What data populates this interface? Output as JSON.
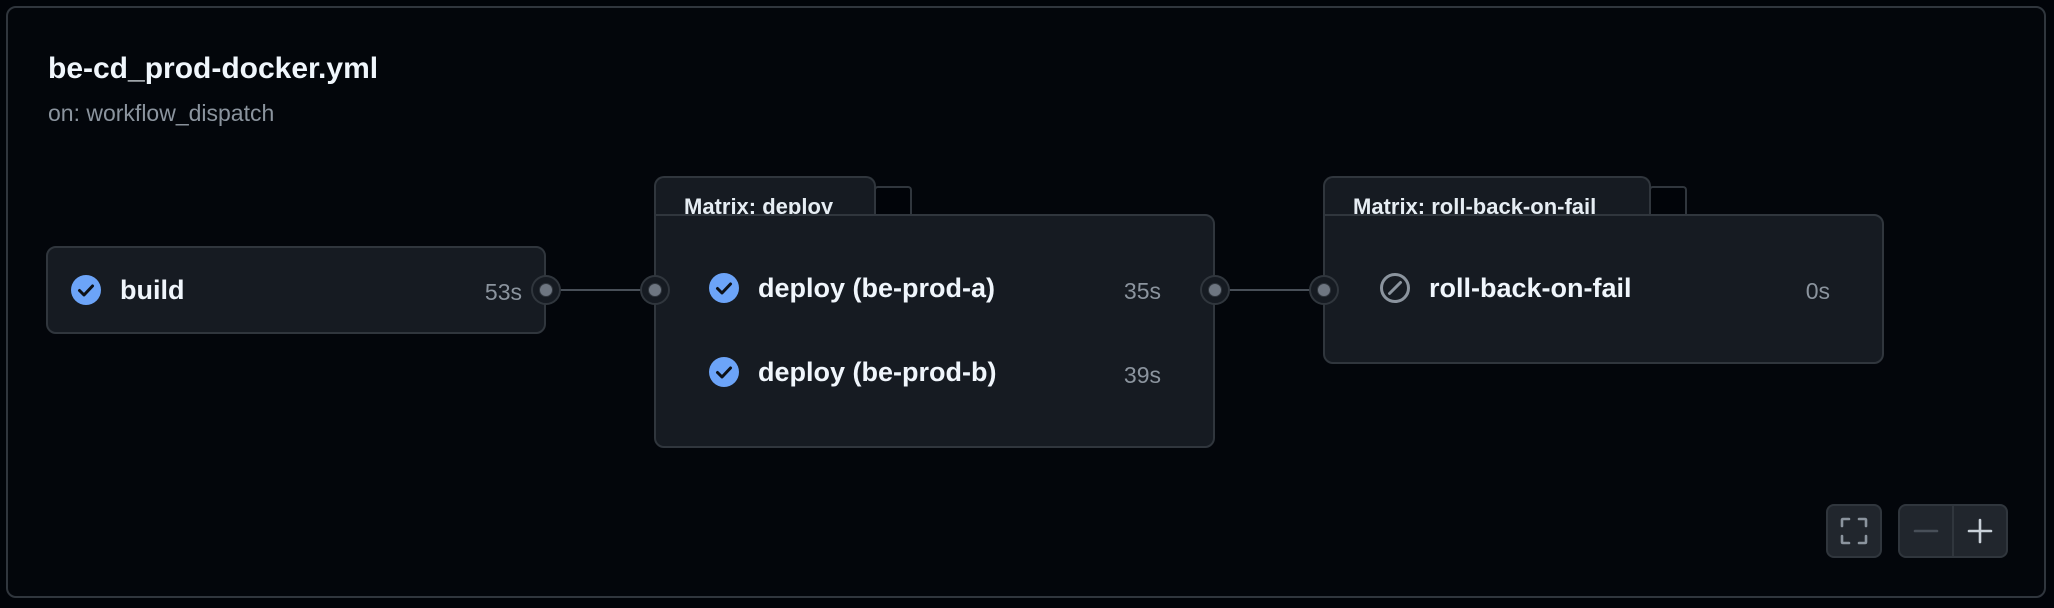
{
  "workflow": {
    "title": "be-cd_prod-docker.yml",
    "trigger": "on: workflow_dispatch"
  },
  "jobs": {
    "build": {
      "label": "build",
      "duration": "53s",
      "status": "success"
    },
    "deploy_group": {
      "title": "Matrix: deploy",
      "items": [
        {
          "label": "deploy (be-prod-a)",
          "duration": "35s",
          "status": "success"
        },
        {
          "label": "deploy (be-prod-b)",
          "duration": "39s",
          "status": "success"
        }
      ]
    },
    "rollback_group": {
      "title": "Matrix: roll-back-on-fail",
      "items": [
        {
          "label": "roll-back-on-fail",
          "duration": "0s",
          "status": "skipped"
        }
      ]
    }
  },
  "icons": {
    "success": "check-circle-icon",
    "skipped": "skip-icon",
    "fullscreen": "fullscreen-icon",
    "zoom_out": "minus-icon",
    "zoom_in": "plus-icon"
  },
  "colors": {
    "success": "#6ca4f8",
    "background": "#010409",
    "card": "#161b22",
    "border": "#30363d",
    "muted": "#8b949e"
  }
}
